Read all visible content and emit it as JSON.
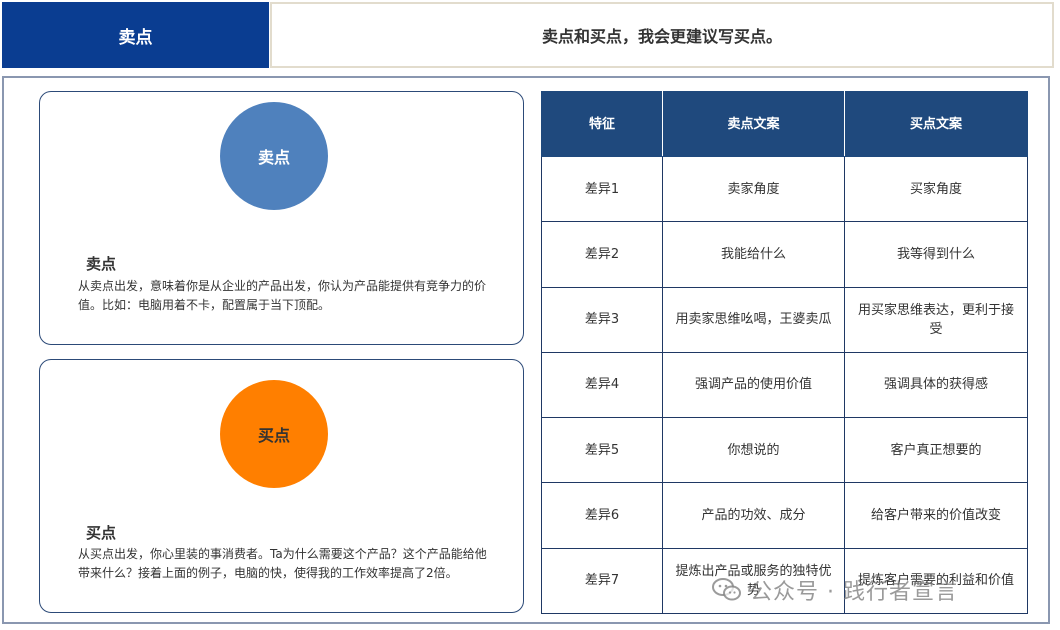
{
  "header": {
    "tab_label": "卖点",
    "subtitle": "卖点和买点，我会更建议写买点。"
  },
  "cards": [
    {
      "circle_label": "卖点",
      "title": "卖点",
      "text": "从卖点出发，意味着你是从企业的产品出发，你认为产品能提供有竞争力的价值。比如：电脑用着不卡，配置属于当下顶配。",
      "circle_color": "#4f81bd"
    },
    {
      "circle_label": "买点",
      "title": "买点",
      "text": "从买点出发，你心里装的事消费者。Ta为什么需要这个产品？这个产品能给他带来什么？接着上面的例子，电脑的快，使得我的工作效率提高了2倍。",
      "circle_color": "#ff7f00"
    }
  ],
  "table": {
    "headers": [
      "特征",
      "卖点文案",
      "买点文案"
    ],
    "rows": [
      [
        "差异1",
        "卖家角度",
        "买家角度"
      ],
      [
        "差异2",
        "我能给什么",
        "我等得到什么"
      ],
      [
        "差异3",
        "用卖家思维吆喝，王婆卖瓜",
        "用买家思维表达，更利于接受"
      ],
      [
        "差异4",
        "强调产品的使用价值",
        "强调具体的获得感"
      ],
      [
        "差异5",
        "你想说的",
        "客户真正想要的"
      ],
      [
        "差异6",
        "产品的功效、成分",
        "给客户带来的价值改变"
      ],
      [
        "差异7",
        "提炼出产品或服务的独特优势",
        "提炼客户需要的利益和价值"
      ]
    ]
  },
  "watermark": {
    "text": "公众号 · 践行者宣言",
    "icon": "wechat-icon"
  },
  "colors": {
    "header_blue": "#0a3d91",
    "table_header": "#1f497d",
    "border_navy": "#1f3864"
  }
}
